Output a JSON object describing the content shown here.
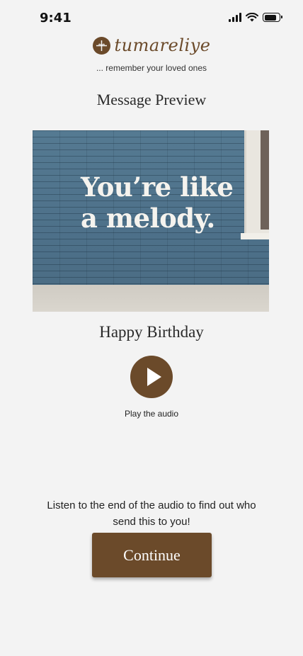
{
  "status_bar": {
    "time": "9:41"
  },
  "brand": {
    "name": "tumareliye",
    "tagline": "... remember your loved ones",
    "color": "#6b4a2a"
  },
  "page": {
    "title": "Message Preview"
  },
  "card": {
    "image_text": "You’re like a melody.",
    "occasion": "Happy Birthday"
  },
  "audio": {
    "play_label": "Play the audio",
    "icon": "play-icon"
  },
  "footer": {
    "instructions": "Listen to the end of the audio to find out who send this to you!",
    "continue_label": "Continue"
  }
}
